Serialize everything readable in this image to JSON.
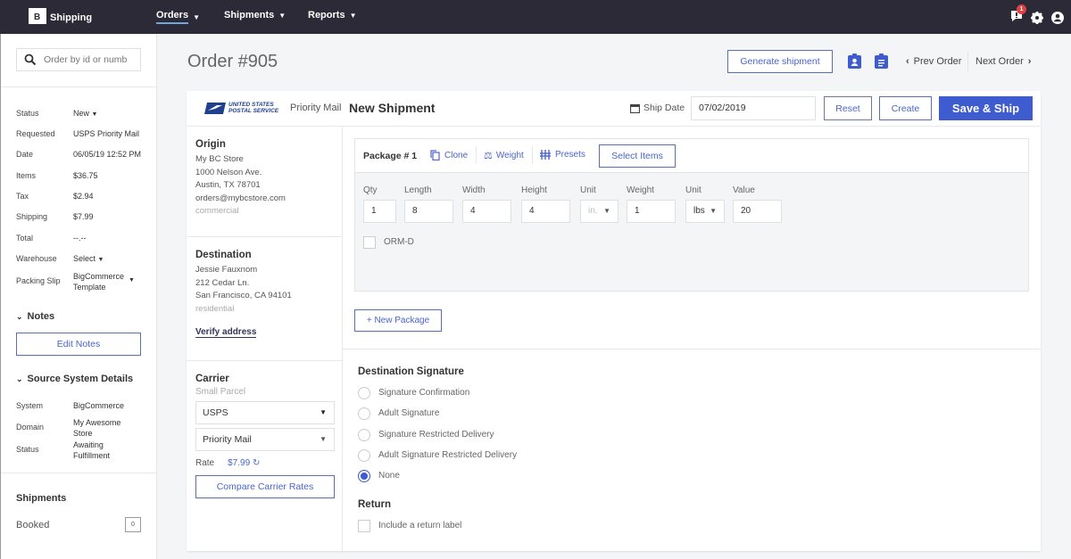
{
  "topbar": {
    "logo_text": "Shipping",
    "logo_letter": "B",
    "nav": [
      {
        "label": "Orders",
        "active": true
      },
      {
        "label": "Shipments",
        "active": false
      },
      {
        "label": "Reports",
        "active": false
      }
    ],
    "notification_count": "1",
    "icons": [
      "notification-icon",
      "gear-icon",
      "user-icon"
    ]
  },
  "sidebar": {
    "search_placeholder": "Order by id or numb",
    "details": {
      "status_label": "Status",
      "status_value": "New",
      "requested_label": "Requested",
      "requested_value": "USPS Priority Mail",
      "date_label": "Date",
      "date_value": "06/05/19 12:52 PM",
      "items_label": "Items",
      "items_value": "$36.75",
      "tax_label": "Tax",
      "tax_value": "$2.94",
      "shipping_label": "Shipping",
      "shipping_value": "$7.99",
      "total_label": "Total",
      "total_value": "--.--",
      "warehouse_label": "Warehouse",
      "warehouse_value": "Select",
      "packing_label": "Packing Slip",
      "packing_value_1": "BigCommerce",
      "packing_value_2": "Template"
    },
    "notes": {
      "title": "Notes",
      "edit_button": "Edit Notes"
    },
    "source": {
      "title": "Source System Details",
      "system_label": "System",
      "system_value": "BigCommerce",
      "domain_label": "Domain",
      "domain_value_1": "My Awesome",
      "domain_value_2": "Store",
      "status_label": "Status",
      "status_value_1": "Awaiting",
      "status_value_2": "Fulfillment"
    },
    "shipments": {
      "title": "Shipments",
      "booked_label": "Booked",
      "booked_count": "0"
    }
  },
  "header": {
    "order_title": "Order #905",
    "generate_button": "Generate shipment",
    "prev_order": "Prev Order",
    "next_order": "Next Order"
  },
  "shipment": {
    "carrier_logo_1": "UNITED STATES",
    "carrier_logo_2": "POSTAL SERVICE",
    "service": "Priority Mail",
    "title": "New Shipment",
    "ship_date_label": "Ship Date",
    "ship_date_value": "07/02/2019",
    "reset_button": "Reset",
    "create_button": "Create",
    "save_ship_button": "Save & Ship",
    "primary_color": "#3f5bd0"
  },
  "origin": {
    "title": "Origin",
    "lines": [
      "My BC Store",
      "1000 Nelson Ave.",
      "Austin, TX 78701",
      "orders@mybcstore.com"
    ],
    "type": "commercial"
  },
  "destination": {
    "title": "Destination",
    "lines": [
      "Jessie Fauxnom",
      "212 Cedar Ln.",
      "San Francisco, CA 94101"
    ],
    "type": "residential",
    "verify_link": "Verify address"
  },
  "carrier": {
    "title": "Carrier",
    "subtitle": "Small Parcel",
    "carrier_value": "USPS",
    "service_value": "Priority Mail",
    "rate_label": "Rate",
    "rate_value": "$7.99",
    "compare_button": "Compare Carrier Rates"
  },
  "package": {
    "title": "Package # 1",
    "clone": "Clone",
    "weight": "Weight",
    "presets": "Presets",
    "select_items": "Select Items",
    "fields": {
      "qty_label": "Qty",
      "qty": "1",
      "length_label": "Length",
      "length": "8",
      "width_label": "Width",
      "width": "4",
      "height_label": "Height",
      "height": "4",
      "unit_label": "Unit",
      "unit": "in.",
      "weight_label": "Weight",
      "weight": "1",
      "weight_unit_label": "Unit",
      "weight_unit": "lbs",
      "value_label": "Value",
      "value": "20"
    },
    "ormd_label": "ORM-D",
    "new_package_button": "+ New Package"
  },
  "signature": {
    "title": "Destination Signature",
    "options": [
      {
        "label": "Signature Confirmation",
        "selected": false
      },
      {
        "label": "Adult Signature",
        "selected": false
      },
      {
        "label": "Signature Restricted Delivery",
        "selected": false
      },
      {
        "label": "Adult Signature Restricted Delivery",
        "selected": false
      },
      {
        "label": "None",
        "selected": true
      }
    ]
  },
  "return": {
    "title": "Return",
    "checkbox_label": "Include a return label"
  }
}
